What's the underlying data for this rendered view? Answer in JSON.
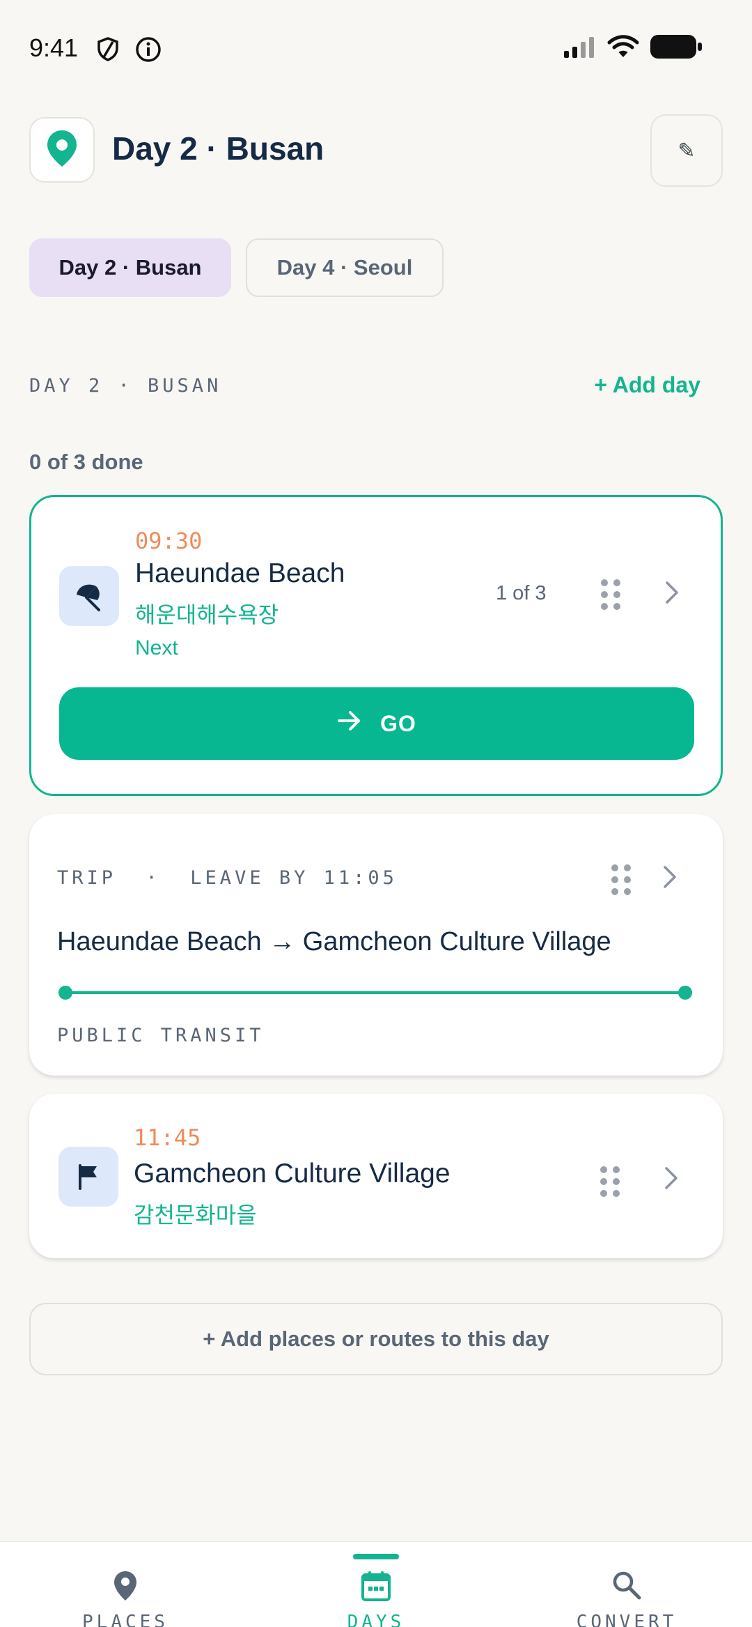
{
  "status_bar": {
    "time": "9:41"
  },
  "header": {
    "title": "Day 2 · Busan",
    "edit_icon": "✎"
  },
  "day_tabs": [
    {
      "label": "Day 2 · Busan",
      "active": true
    },
    {
      "label": "Day 4 · Seoul",
      "active": false
    }
  ],
  "section": {
    "label": "DAY 2 · BUSAN",
    "add_day_label": "+ Add day",
    "progress": "0 of 3 done"
  },
  "current_stop": {
    "time": "09:30",
    "name": "Haeundae Beach",
    "native_name": "해운대해수욕장",
    "status": "Next",
    "order": "1 of 3",
    "go_label": "GO",
    "icon": "beach-umbrella-icon"
  },
  "trip": {
    "header": "TRIP  ·  LEAVE BY 11:05",
    "route": "Haeundae Beach → Gamcheon Culture Village",
    "mode": "PUBLIC TRANSIT"
  },
  "next_stop": {
    "time": "11:45",
    "name": "Gamcheon Culture Village",
    "native_name": "감천문화마을",
    "icon": "flag-icon"
  },
  "add_places_label": "+ Add places or routes to this day",
  "bottom_nav": [
    {
      "label": "PLACES",
      "icon": "map-pin-icon",
      "active": false
    },
    {
      "label": "DAYS",
      "icon": "calendar-icon",
      "active": true
    },
    {
      "label": "CONVERT",
      "icon": "search-icon",
      "active": false
    }
  ],
  "colors": {
    "accent": "#12b58f",
    "time": "#f08b5a",
    "chip_active": "#e8dff5",
    "text_dark": "#152a45"
  }
}
